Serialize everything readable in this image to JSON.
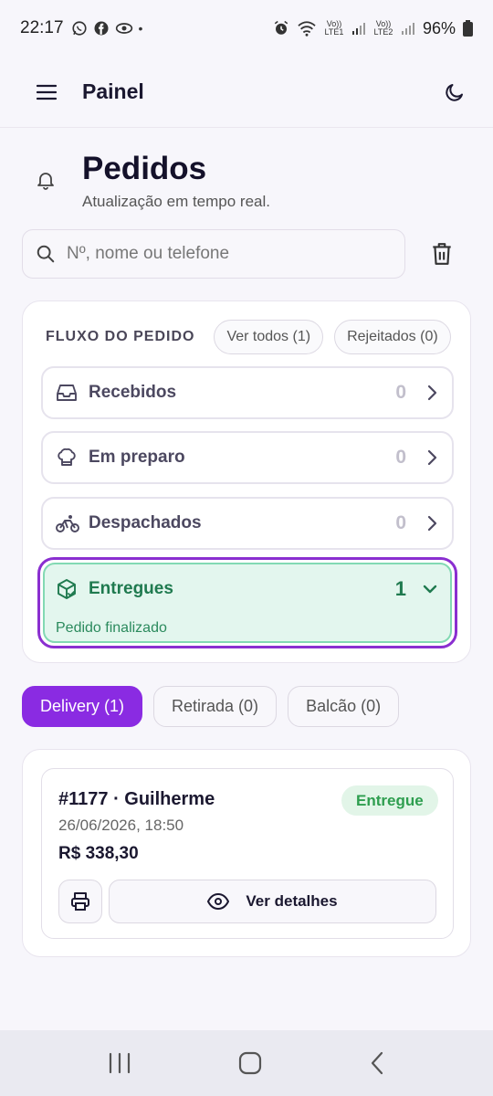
{
  "status_bar": {
    "time": "22:17",
    "app_icons": [
      "whatsapp-icon",
      "facebook-icon",
      "eye-icon"
    ],
    "dot": "•",
    "volte1": "Vo)) LTE1",
    "volte2": "Vo)) LTE2",
    "battery": "96%"
  },
  "appbar": {
    "title": "Painel"
  },
  "header": {
    "title": "Pedidos",
    "subtitle": "Atualização em tempo real."
  },
  "search": {
    "placeholder": "Nº, nome ou telefone",
    "value": ""
  },
  "flow": {
    "label": "FLUXO DO PEDIDO",
    "view_all": "Ver todos (1)",
    "rejected": "Rejeitados (0)",
    "stages": [
      {
        "name": "Recebidos",
        "count": "0",
        "icon": "inbox-icon"
      },
      {
        "name": "Em preparo",
        "count": "0",
        "icon": "chef-hat-icon"
      },
      {
        "name": "Despachados",
        "count": "0",
        "icon": "bike-icon"
      }
    ],
    "active_stage": {
      "name": "Entregues",
      "count": "1",
      "description": "Pedido finalizado",
      "icon": "package-check-icon"
    }
  },
  "tabs": [
    {
      "label": "Delivery (1)",
      "active": true
    },
    {
      "label": "Retirada (0)",
      "active": false
    },
    {
      "label": "Balcão (0)",
      "active": false
    }
  ],
  "order": {
    "id_name": "#1177 · Guilherme",
    "status": "Entregue",
    "datetime": "26/06/2026, 18:50",
    "total": "R$ 338,30",
    "details_label": "Ver detalhes"
  },
  "colors": {
    "accent": "#8a2be2",
    "success": "#2e9e4f",
    "success_bg": "#e3f6ee"
  }
}
